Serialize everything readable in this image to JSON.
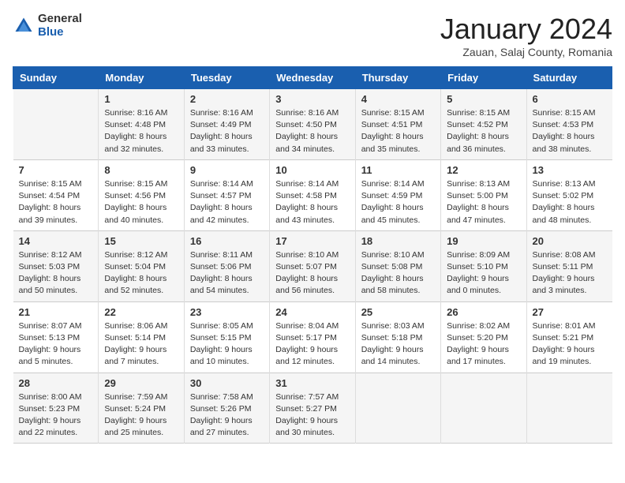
{
  "header": {
    "logo_general": "General",
    "logo_blue": "Blue",
    "month_title": "January 2024",
    "subtitle": "Zauan, Salaj County, Romania"
  },
  "weekdays": [
    "Sunday",
    "Monday",
    "Tuesday",
    "Wednesday",
    "Thursday",
    "Friday",
    "Saturday"
  ],
  "weeks": [
    [
      {
        "day": "",
        "info": ""
      },
      {
        "day": "1",
        "info": "Sunrise: 8:16 AM\nSunset: 4:48 PM\nDaylight: 8 hours\nand 32 minutes."
      },
      {
        "day": "2",
        "info": "Sunrise: 8:16 AM\nSunset: 4:49 PM\nDaylight: 8 hours\nand 33 minutes."
      },
      {
        "day": "3",
        "info": "Sunrise: 8:16 AM\nSunset: 4:50 PM\nDaylight: 8 hours\nand 34 minutes."
      },
      {
        "day": "4",
        "info": "Sunrise: 8:15 AM\nSunset: 4:51 PM\nDaylight: 8 hours\nand 35 minutes."
      },
      {
        "day": "5",
        "info": "Sunrise: 8:15 AM\nSunset: 4:52 PM\nDaylight: 8 hours\nand 36 minutes."
      },
      {
        "day": "6",
        "info": "Sunrise: 8:15 AM\nSunset: 4:53 PM\nDaylight: 8 hours\nand 38 minutes."
      }
    ],
    [
      {
        "day": "7",
        "info": "Sunrise: 8:15 AM\nSunset: 4:54 PM\nDaylight: 8 hours\nand 39 minutes."
      },
      {
        "day": "8",
        "info": "Sunrise: 8:15 AM\nSunset: 4:56 PM\nDaylight: 8 hours\nand 40 minutes."
      },
      {
        "day": "9",
        "info": "Sunrise: 8:14 AM\nSunset: 4:57 PM\nDaylight: 8 hours\nand 42 minutes."
      },
      {
        "day": "10",
        "info": "Sunrise: 8:14 AM\nSunset: 4:58 PM\nDaylight: 8 hours\nand 43 minutes."
      },
      {
        "day": "11",
        "info": "Sunrise: 8:14 AM\nSunset: 4:59 PM\nDaylight: 8 hours\nand 45 minutes."
      },
      {
        "day": "12",
        "info": "Sunrise: 8:13 AM\nSunset: 5:00 PM\nDaylight: 8 hours\nand 47 minutes."
      },
      {
        "day": "13",
        "info": "Sunrise: 8:13 AM\nSunset: 5:02 PM\nDaylight: 8 hours\nand 48 minutes."
      }
    ],
    [
      {
        "day": "14",
        "info": "Sunrise: 8:12 AM\nSunset: 5:03 PM\nDaylight: 8 hours\nand 50 minutes."
      },
      {
        "day": "15",
        "info": "Sunrise: 8:12 AM\nSunset: 5:04 PM\nDaylight: 8 hours\nand 52 minutes."
      },
      {
        "day": "16",
        "info": "Sunrise: 8:11 AM\nSunset: 5:06 PM\nDaylight: 8 hours\nand 54 minutes."
      },
      {
        "day": "17",
        "info": "Sunrise: 8:10 AM\nSunset: 5:07 PM\nDaylight: 8 hours\nand 56 minutes."
      },
      {
        "day": "18",
        "info": "Sunrise: 8:10 AM\nSunset: 5:08 PM\nDaylight: 8 hours\nand 58 minutes."
      },
      {
        "day": "19",
        "info": "Sunrise: 8:09 AM\nSunset: 5:10 PM\nDaylight: 9 hours\nand 0 minutes."
      },
      {
        "day": "20",
        "info": "Sunrise: 8:08 AM\nSunset: 5:11 PM\nDaylight: 9 hours\nand 3 minutes."
      }
    ],
    [
      {
        "day": "21",
        "info": "Sunrise: 8:07 AM\nSunset: 5:13 PM\nDaylight: 9 hours\nand 5 minutes."
      },
      {
        "day": "22",
        "info": "Sunrise: 8:06 AM\nSunset: 5:14 PM\nDaylight: 9 hours\nand 7 minutes."
      },
      {
        "day": "23",
        "info": "Sunrise: 8:05 AM\nSunset: 5:15 PM\nDaylight: 9 hours\nand 10 minutes."
      },
      {
        "day": "24",
        "info": "Sunrise: 8:04 AM\nSunset: 5:17 PM\nDaylight: 9 hours\nand 12 minutes."
      },
      {
        "day": "25",
        "info": "Sunrise: 8:03 AM\nSunset: 5:18 PM\nDaylight: 9 hours\nand 14 minutes."
      },
      {
        "day": "26",
        "info": "Sunrise: 8:02 AM\nSunset: 5:20 PM\nDaylight: 9 hours\nand 17 minutes."
      },
      {
        "day": "27",
        "info": "Sunrise: 8:01 AM\nSunset: 5:21 PM\nDaylight: 9 hours\nand 19 minutes."
      }
    ],
    [
      {
        "day": "28",
        "info": "Sunrise: 8:00 AM\nSunset: 5:23 PM\nDaylight: 9 hours\nand 22 minutes."
      },
      {
        "day": "29",
        "info": "Sunrise: 7:59 AM\nSunset: 5:24 PM\nDaylight: 9 hours\nand 25 minutes."
      },
      {
        "day": "30",
        "info": "Sunrise: 7:58 AM\nSunset: 5:26 PM\nDaylight: 9 hours\nand 27 minutes."
      },
      {
        "day": "31",
        "info": "Sunrise: 7:57 AM\nSunset: 5:27 PM\nDaylight: 9 hours\nand 30 minutes."
      },
      {
        "day": "",
        "info": ""
      },
      {
        "day": "",
        "info": ""
      },
      {
        "day": "",
        "info": ""
      }
    ]
  ]
}
